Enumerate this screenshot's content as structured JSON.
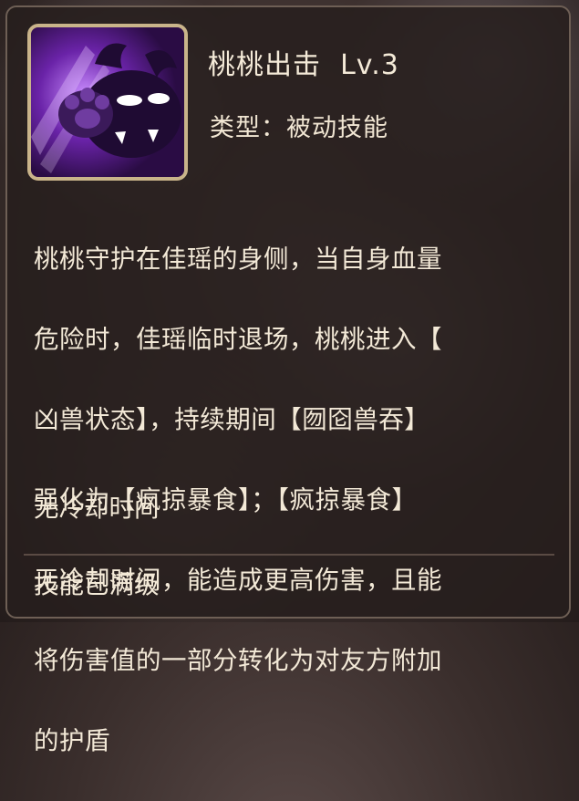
{
  "skill": {
    "name": "桃桃出击",
    "level": "Lv.3",
    "type_label": "类型：被动技能",
    "icon": "purple-beast-icon",
    "description_lines": [
      "桃桃守护在佳瑶的身侧，当自身血量",
      "危险时，佳瑶临时退场，桃桃进入【",
      "凶兽状态】，持续期间【囫囵兽吞】",
      "强化为【疯掠暴食】；【疯掠暴食】",
      "无冷却时间，能造成更高伤害，且能",
      "将伤害值的一部分转化为对友方附加",
      "的护盾"
    ],
    "cooldown": "无冷却时间",
    "max_level_text": "技能已满级"
  },
  "colors": {
    "panel_bg": "#261e1d",
    "border": "#6e5f55",
    "text": "#f3e9d7",
    "icon_purple": "#5c1f8c"
  }
}
